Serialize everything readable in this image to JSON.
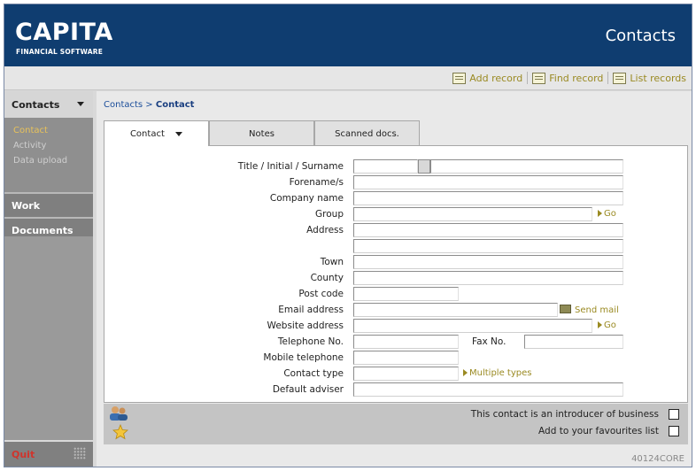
{
  "header": {
    "brand": "CAPITA",
    "brand_sub": "FINANCIAL SOFTWARE",
    "page_title": "Contacts"
  },
  "toolbar": {
    "add_record": "Add record",
    "find_record": "Find record",
    "list_records": "List records"
  },
  "sidebar": {
    "section_contacts": "Contacts",
    "sub_items": [
      "Contact",
      "Activity",
      "Data upload"
    ],
    "section_work": "Work",
    "section_documents": "Documents",
    "quit": "Quit"
  },
  "breadcrumb": {
    "parent": "Contacts",
    "separator": " > ",
    "current": "Contact"
  },
  "tabs": [
    "Contact",
    "Notes",
    "Scanned docs."
  ],
  "form": {
    "title_initial_surname": "Title / Initial / Surname",
    "forenames": "Forename/s",
    "company_name": "Company name",
    "group": "Group",
    "address": "Address",
    "town": "Town",
    "county": "County",
    "post_code": "Post code",
    "email_address": "Email address",
    "website_address": "Website address",
    "telephone_no": "Telephone No.",
    "fax_no": "Fax No.",
    "mobile_telephone": "Mobile telephone",
    "contact_type": "Contact type",
    "default_adviser": "Default adviser",
    "go": "Go",
    "send_mail": "Send mail",
    "multiple_types": "Multiple types"
  },
  "options": {
    "introducer_label": "This contact is an introducer of business",
    "favourites_label": "Add  to your favourites list"
  },
  "footer": {
    "version": "40124CORE"
  },
  "colors": {
    "header_bg": "#0f3d70",
    "accent_link": "#9a8a22",
    "quit": "#d0342c",
    "current_nav": "#e8c25a"
  },
  "icons": {
    "add_record": "add-record-icon",
    "find_record": "find-record-icon",
    "list_records": "list-records-icon",
    "people": "people-icon",
    "star": "star-icon",
    "mail": "mail-icon"
  }
}
